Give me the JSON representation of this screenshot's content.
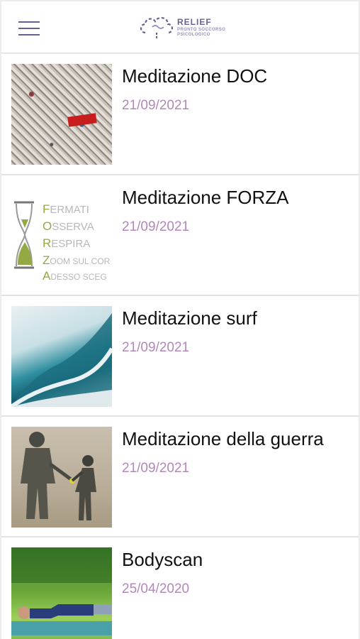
{
  "header": {
    "logo_title": "RELIEF",
    "logo_subtitle_1": "PRONTO SOCCORSO",
    "logo_subtitle_2": "PSICOLOGICO"
  },
  "items": [
    {
      "title": "Meditazione DOC",
      "date": "21/09/2021",
      "thumb": "collage-image"
    },
    {
      "title": "Meditazione FORZA",
      "date": "21/09/2021",
      "thumb": "hourglass-forza-image",
      "forza_lines": [
        {
          "initial": "F",
          "rest": "ERMATI"
        },
        {
          "initial": "O",
          "rest": "SSERVA"
        },
        {
          "initial": "R",
          "rest": "ESPIRA"
        },
        {
          "initial": "Z",
          "rest": "OOM SUL COR"
        },
        {
          "initial": "A",
          "rest": "DESSO SCEG"
        }
      ]
    },
    {
      "title": "Meditazione surf",
      "date": "21/09/2021",
      "thumb": "wave-image"
    },
    {
      "title": "Meditazione della guerra",
      "date": "21/09/2021",
      "thumb": "soldier-child-image"
    },
    {
      "title": "Bodyscan",
      "date": "25/04/2020",
      "thumb": "person-lying-grass-image"
    }
  ],
  "colors": {
    "accent": "#6b5f94",
    "date": "#b287b9",
    "forza_green": "#93a944"
  }
}
